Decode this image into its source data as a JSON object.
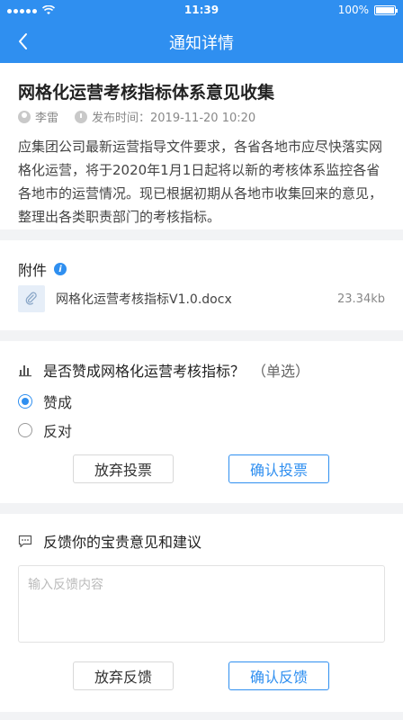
{
  "statusbar": {
    "time": "11:39",
    "battery": "100%"
  },
  "nav": {
    "title": "通知详情"
  },
  "notice": {
    "title": "网格化运营考核指标体系意见收集",
    "author": "李雷",
    "publish": "发布时间：2019-11-20 10:20",
    "body": "应集团公司最新运营指导文件要求，各省各地市应尽快落实网格化运营，将于2020年1月1日起将以新的考核体系监控各省各地市的运营情况。现已根据初期从各地市收集回来的意见，整理出各类职责部门的考核指标。"
  },
  "attachment": {
    "label": "附件",
    "file_name": "网格化运营考核指标V1.0.docx",
    "file_size": "23.34kb"
  },
  "vote": {
    "question": "是否赞成网格化运营考核指标？",
    "mode": "（单选）",
    "options": [
      {
        "label": "赞成",
        "checked": true
      },
      {
        "label": "反对",
        "checked": false
      }
    ],
    "abandon": "放弃投票",
    "confirm": "确认投票"
  },
  "feedback": {
    "title": "反馈你的宝贵意见和建议",
    "placeholder": "输入反馈内容",
    "abandon": "放弃反馈",
    "confirm": "确认反馈"
  },
  "colors": {
    "primary": "#2f8ff0",
    "background": "#f2f3f5"
  }
}
